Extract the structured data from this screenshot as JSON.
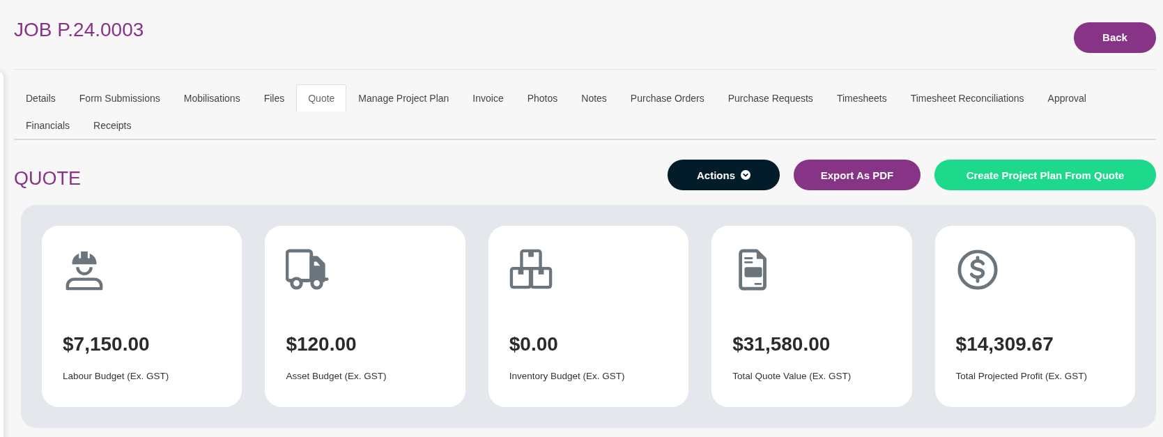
{
  "page": {
    "title": "JOB P.24.0003",
    "back_button": "Back"
  },
  "tabs": [
    {
      "label": "Details",
      "selected": false
    },
    {
      "label": "Form Submissions",
      "selected": false
    },
    {
      "label": "Mobilisations",
      "selected": false
    },
    {
      "label": "Files",
      "selected": false
    },
    {
      "label": "Quote",
      "selected": true
    },
    {
      "label": "Manage Project Plan",
      "selected": false
    },
    {
      "label": "Invoice",
      "selected": false
    },
    {
      "label": "Photos",
      "selected": false
    },
    {
      "label": "Notes",
      "selected": false
    },
    {
      "label": "Purchase Orders",
      "selected": false
    },
    {
      "label": "Purchase Requests",
      "selected": false
    },
    {
      "label": "Timesheets",
      "selected": false
    },
    {
      "label": "Timesheet Reconciliations",
      "selected": false
    },
    {
      "label": "Approval",
      "selected": false
    },
    {
      "label": "Financials",
      "selected": false
    },
    {
      "label": "Receipts",
      "selected": false
    }
  ],
  "section": {
    "title": "QUOTE",
    "actions": [
      {
        "label": "Actions",
        "kind": "dropdown"
      },
      {
        "label": "Export As PDF",
        "kind": "export"
      },
      {
        "label": "Create Project Plan From Quote",
        "kind": "create"
      }
    ]
  },
  "cards": [
    {
      "kind": "worker",
      "value": "$7,150.00",
      "label": "Labour Budget (Ex. GST)"
    },
    {
      "kind": "truck",
      "value": "$120.00",
      "label": "Asset Budget (Ex. GST)"
    },
    {
      "kind": "boxes",
      "value": "$0.00",
      "label": "Inventory Budget (Ex. GST)"
    },
    {
      "kind": "document",
      "value": "$31,580.00",
      "label": "Total Quote Value (Ex. GST)"
    },
    {
      "kind": "dollar",
      "value": "$14,309.67",
      "label": "Total Projected Profit (Ex. GST)"
    }
  ]
}
